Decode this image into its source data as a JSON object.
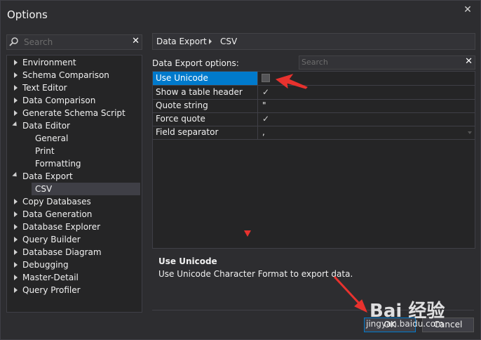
{
  "window": {
    "title": "Options",
    "close_glyph": "✕"
  },
  "left": {
    "search_placeholder": "Search",
    "clear_glyph": "✕",
    "tree": [
      {
        "label": "Environment",
        "state": "collapsed",
        "level": 0
      },
      {
        "label": "Schema Comparison",
        "state": "collapsed",
        "level": 0
      },
      {
        "label": "Text Editor",
        "state": "collapsed",
        "level": 0
      },
      {
        "label": "Data Comparison",
        "state": "collapsed",
        "level": 0
      },
      {
        "label": "Generate Schema Script",
        "state": "collapsed",
        "level": 0
      },
      {
        "label": "Data Editor",
        "state": "expanded",
        "level": 0
      },
      {
        "label": "General",
        "state": "leaf",
        "level": 1
      },
      {
        "label": "Print",
        "state": "leaf",
        "level": 1
      },
      {
        "label": "Formatting",
        "state": "leaf",
        "level": 1
      },
      {
        "label": "Data Export",
        "state": "expanded",
        "level": 0
      },
      {
        "label": "CSV",
        "state": "leaf",
        "level": 1,
        "selected": true
      },
      {
        "label": "Copy Databases",
        "state": "collapsed",
        "level": 0
      },
      {
        "label": "Data Generation",
        "state": "collapsed",
        "level": 0
      },
      {
        "label": "Database Explorer",
        "state": "collapsed",
        "level": 0
      },
      {
        "label": "Query Builder",
        "state": "collapsed",
        "level": 0
      },
      {
        "label": "Database Diagram",
        "state": "collapsed",
        "level": 0
      },
      {
        "label": "Debugging",
        "state": "collapsed",
        "level": 0
      },
      {
        "label": "Master-Detail",
        "state": "collapsed",
        "level": 0
      },
      {
        "label": "Query Profiler",
        "state": "collapsed",
        "level": 0
      }
    ]
  },
  "right": {
    "breadcrumb": [
      "Data Export",
      "CSV"
    ],
    "options_label": "Data Export options:",
    "search_placeholder": "Search",
    "clear_glyph": "✕",
    "rows": [
      {
        "name": "Use Unicode",
        "type": "checkbox",
        "checked": false,
        "selected": true
      },
      {
        "name": "Show a table header",
        "type": "checkbox",
        "checked": true
      },
      {
        "name": "Quote string",
        "type": "text",
        "value": "\""
      },
      {
        "name": "Force quote",
        "type": "checkbox",
        "checked": true
      },
      {
        "name": "Field separator",
        "type": "dropdown",
        "value": ","
      }
    ],
    "description": {
      "heading": "Use Unicode",
      "text": "Use Unicode Character Format to export data."
    }
  },
  "buttons": {
    "ok": "OK",
    "cancel": "Cancel"
  },
  "watermark": {
    "logo": "Bai 经验",
    "url": "jingyan.baidu.com"
  },
  "colors": {
    "accent": "#007acc",
    "background": "#2d2d30",
    "annotation": "#e8322e"
  },
  "icons": {
    "check": "✓"
  }
}
